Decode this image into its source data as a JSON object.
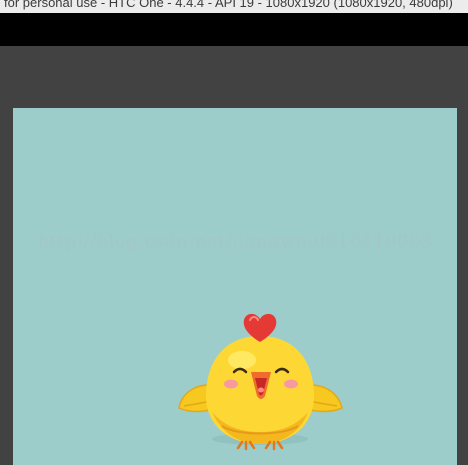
{
  "window": {
    "title": "for personal use - HTC One - 4.4.4 - API 19 - 1080x1920 (1080x1920, 480dpi)"
  },
  "screen": {
    "background_color": "#9ccdcb",
    "watermark": "http://blog.csdn.net/jiangwei0910410003"
  },
  "content": {
    "image": "yellow-chick-with-heart-icon"
  }
}
